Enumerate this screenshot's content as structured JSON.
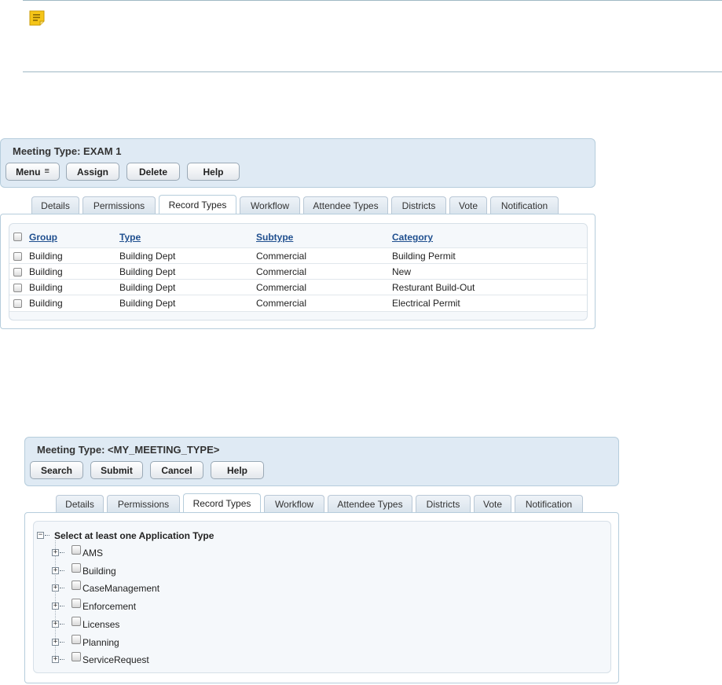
{
  "panel1": {
    "title": "Meeting Type: EXAM 1",
    "buttons": {
      "menu": "Menu",
      "assign": "Assign",
      "delete": "Delete",
      "help": "Help"
    },
    "tabs": [
      "Details",
      "Permissions",
      "Record Types",
      "Workflow",
      "Attendee Types",
      "Districts",
      "Vote",
      "Notification"
    ],
    "active_tab": "Record Types",
    "table": {
      "headers": [
        "Group",
        "Type",
        "Subtype",
        "Category"
      ],
      "rows": [
        [
          "Building",
          "Building Dept",
          "Commercial",
          "Building Permit"
        ],
        [
          "Building",
          "Building Dept",
          "Commercial",
          "New"
        ],
        [
          "Building",
          "Building Dept",
          "Commercial",
          "Resturant Build-Out"
        ],
        [
          "Building",
          "Building Dept",
          "Commercial",
          "Electrical Permit"
        ]
      ]
    }
  },
  "panel2": {
    "title": "Meeting Type: <MY_MEETING_TYPE>",
    "buttons": {
      "search": "Search",
      "submit": "Submit",
      "cancel": "Cancel",
      "help": "Help"
    },
    "tabs": [
      "Details",
      "Permissions",
      "Record Types",
      "Workflow",
      "Attendee Types",
      "Districts",
      "Vote",
      "Notification"
    ],
    "active_tab": "Record Types",
    "tree": {
      "root_label": "Select at least one Application Type",
      "items": [
        "AMS",
        "Building",
        "CaseManagement",
        "Enforcement",
        "Licenses",
        "Planning",
        "ServiceRequest"
      ]
    }
  },
  "icons": {
    "note": "note-icon",
    "menu_caret": "menu-caret-icon"
  },
  "colors": {
    "panel_bg": "#dfeaf4",
    "link": "#1f4f8f",
    "note_icon": "#f5c518"
  }
}
